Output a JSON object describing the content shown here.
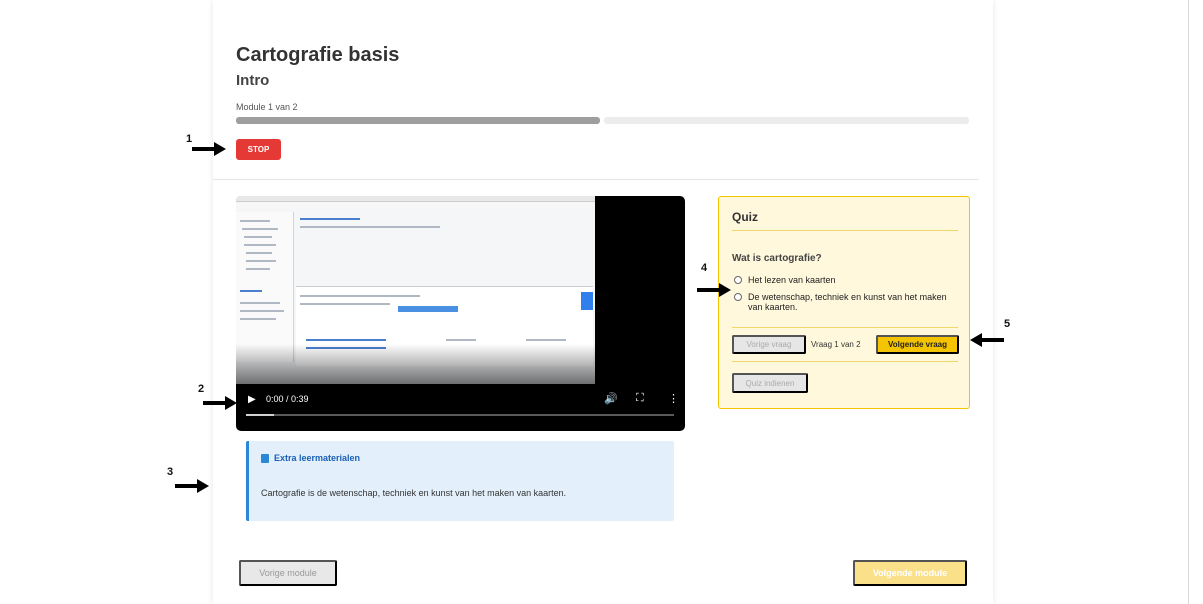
{
  "course": {
    "title": "Cartografie basis",
    "module_title": "Intro"
  },
  "progress": {
    "label": "Module 1 van 2",
    "completed_fraction": 0.5
  },
  "stop_button": {
    "label": "STOP"
  },
  "video": {
    "time": "0:00 / 0:39",
    "play_icon": "play-icon",
    "volume_icon": "volume-icon",
    "fullscreen_icon": "fullscreen-icon",
    "more_icon": "more-vertical-icon"
  },
  "extra": {
    "icon": "book-icon",
    "title": "Extra leermaterialen",
    "text": "Cartografie is de wetenschap, techniek en kunst van het maken van kaarten."
  },
  "quiz": {
    "title": "Quiz",
    "question": "Wat is cartografie?",
    "options": [
      "Het lezen van kaarten",
      "De wetenschap, techniek en kunst van het maken van kaarten."
    ],
    "prev_label": "Vorige vraag",
    "counter": "Vraag 1 van 2",
    "next_label": "Volgende vraag",
    "submit_label": "Quiz indienen"
  },
  "nav": {
    "prev_module": "Vorige module",
    "next_module": "Volgende module"
  },
  "annotations": [
    "1",
    "2",
    "3",
    "4",
    "5"
  ],
  "colors": {
    "stop": "#e53935",
    "accent": "#f5c400",
    "info": "#2b88d8"
  }
}
